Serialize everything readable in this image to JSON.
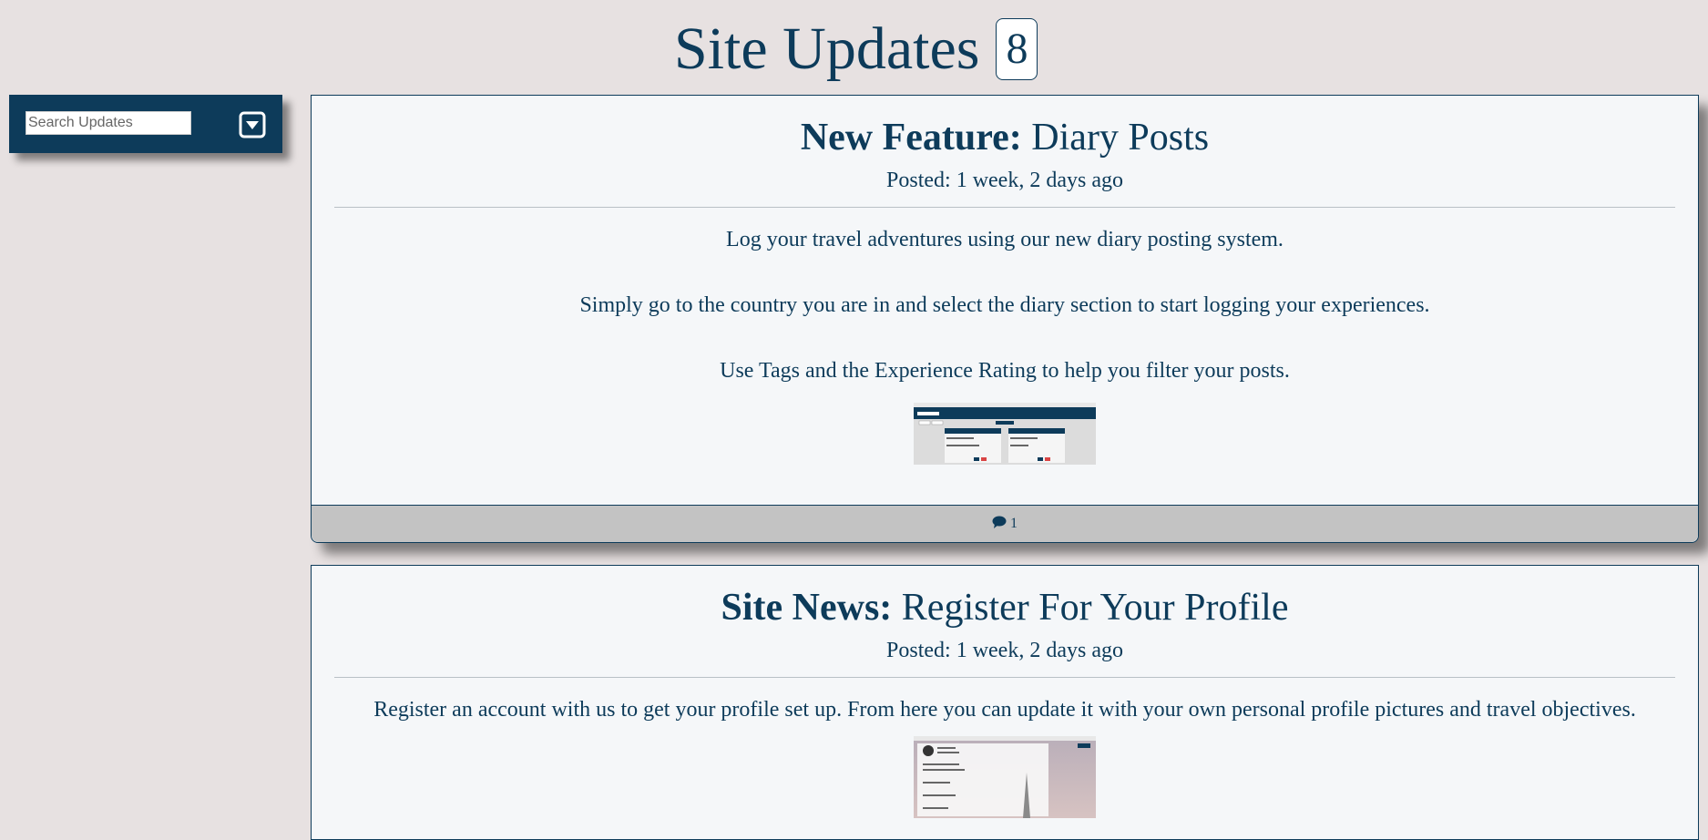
{
  "header": {
    "title": "Site Updates",
    "count": "8"
  },
  "sidebar": {
    "search_placeholder": "Search Updates",
    "dropdown_icon": "caret-down-square-icon"
  },
  "posts": [
    {
      "category": "New Feature:",
      "title": "Diary Posts",
      "posted": "Posted: 1 week, 2 days ago",
      "paragraphs": [
        "Log your travel adventures using our new diary posting system.",
        "Simply go to the country you are in and select the diary section to start logging your experiences.",
        "Use Tags and the Experience Rating to help you filter your posts."
      ],
      "comments": "1",
      "comment_icon": "speech-bubble-icon"
    },
    {
      "category": "Site News:",
      "title": "Register For Your Profile",
      "posted": "Posted: 1 week, 2 days ago",
      "paragraphs": [
        "Register an account with us to get your profile set up. From here you can update it with your own personal profile pictures and travel objectives."
      ]
    }
  ],
  "colors": {
    "primary": "#0d3b5a",
    "background": "#e7e1e1",
    "card": "#f5f7f9",
    "footer": "#c3c3c3"
  }
}
